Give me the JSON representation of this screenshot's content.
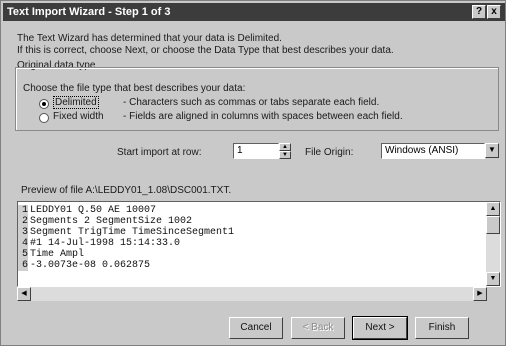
{
  "window": {
    "title": "Text Import Wizard - Step 1 of 3",
    "help_btn": "?",
    "close_btn": "x"
  },
  "intro": {
    "line1": "The Text Wizard has determined that your data is Delimited.",
    "line2": "If this is correct, choose Next, or choose the Data Type that best describes your data."
  },
  "original_data_type": {
    "group_label": "Original data type",
    "prompt": "Choose the file type that best describes your data:",
    "options": [
      {
        "label": "Delimited",
        "desc": "- Characters such as commas or tabs separate each field.",
        "selected": true
      },
      {
        "label": "Fixed width",
        "desc": "- Fields are aligned in columns with spaces between each field.",
        "selected": false
      }
    ]
  },
  "import_options": {
    "start_row_label": "Start import at row:",
    "start_row_value": "1",
    "file_origin_label": "File Origin:",
    "file_origin_value": "Windows (ANSI)"
  },
  "preview": {
    "label": "Preview of file A:\\LEDDY01_1.08\\DSC001.TXT.",
    "lines": [
      {
        "num": "1",
        "text": "LEDDY01 Q.50 AE 10007"
      },
      {
        "num": "2",
        "text": "Segments 2 SegmentSize 1002"
      },
      {
        "num": "3",
        "text": "Segment  TrigTime TimeSinceSegment1"
      },
      {
        "num": "4",
        "text": "#1 14-Jul-1998 15:14:33.0"
      },
      {
        "num": "5",
        "text": "Time Ampl"
      },
      {
        "num": "6",
        "text": "-3.0073e-08 0.062875"
      }
    ]
  },
  "buttons": {
    "cancel": "Cancel",
    "back": "< Back",
    "next": "Next >",
    "finish": "Finish"
  }
}
